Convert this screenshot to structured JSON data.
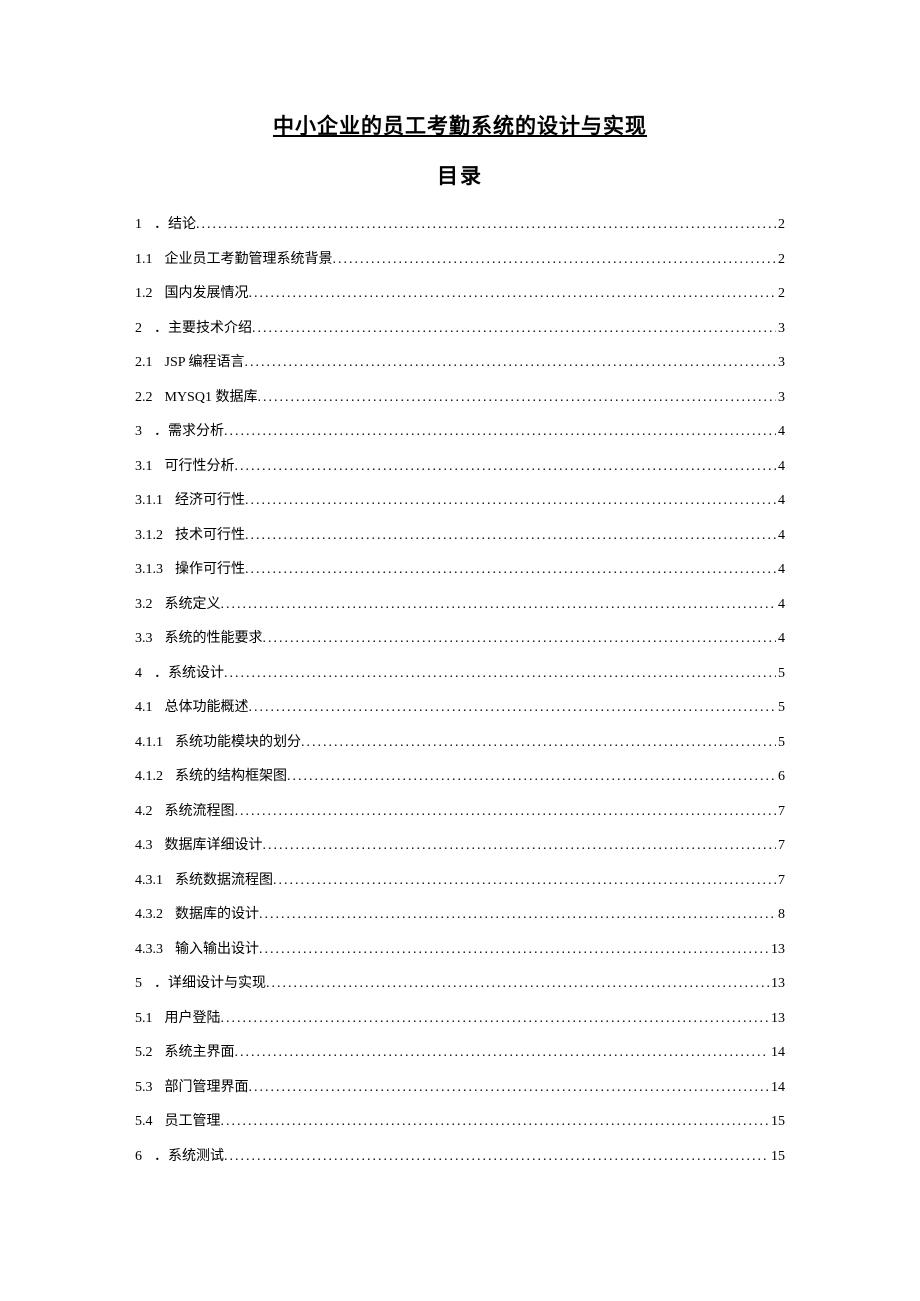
{
  "title": "中小企业的员工考勤系统的设计与实现",
  "toc_heading": "目录",
  "entries": [
    {
      "num": "1",
      "text": "．结论",
      "page": "2"
    },
    {
      "num": "1.1",
      "text": "企业员工考勤管理系统背景",
      "page": "2"
    },
    {
      "num": "1.2",
      "text": "国内发展情况",
      "page": "2"
    },
    {
      "num": "2",
      "text": "．主要技术介绍",
      "page": "3"
    },
    {
      "num": "2.1",
      "text": "JSP 编程语言",
      "page": "3"
    },
    {
      "num": "2.2",
      "text": "MYSQ1 数据库",
      "page": "3"
    },
    {
      "num": "3",
      "text": "．需求分析",
      "page": "4"
    },
    {
      "num": "3.1",
      "text": "可行性分析",
      "page": "4"
    },
    {
      "num": "3.1.1",
      "text": "经济可行性",
      "page": "4"
    },
    {
      "num": "3.1.2",
      "text": "技术可行性",
      "page": "4"
    },
    {
      "num": "3.1.3",
      "text": "操作可行性",
      "page": "4"
    },
    {
      "num": "3.2",
      "text": "系统定义",
      "page": "4"
    },
    {
      "num": "3.3",
      "text": "系统的性能要求",
      "page": "4"
    },
    {
      "num": "4",
      "text": "．系统设计",
      "page": "5"
    },
    {
      "num": "4.1",
      "text": "总体功能概述",
      "page": "5"
    },
    {
      "num": "4.1.1",
      "text": "系统功能模块的划分",
      "page": "5"
    },
    {
      "num": "4.1.2",
      "text": "系统的结构框架图",
      "page": "6"
    },
    {
      "num": "4.2",
      "text": "系统流程图",
      "page": "7"
    },
    {
      "num": "4.3",
      "text": "数据库详细设计",
      "page": "7"
    },
    {
      "num": "4.3.1",
      "text": "系统数据流程图",
      "page": "7"
    },
    {
      "num": "4.3.2",
      "text": "数据库的设计",
      "page": "8"
    },
    {
      "num": "4.3.3",
      "text": "输入输出设计",
      "page": "13"
    },
    {
      "num": "5",
      "text": "．详细设计与实现",
      "page": "13"
    },
    {
      "num": "5.1",
      "text": "用户登陆",
      "page": "13"
    },
    {
      "num": "5.2",
      "text": "系统主界面",
      "page": "14"
    },
    {
      "num": "5.3",
      "text": "部门管理界面",
      "page": "14"
    },
    {
      "num": "5.4",
      "text": "员工管理",
      "page": "15"
    },
    {
      "num": "6",
      "text": "．系统测试",
      "page": "15"
    }
  ]
}
